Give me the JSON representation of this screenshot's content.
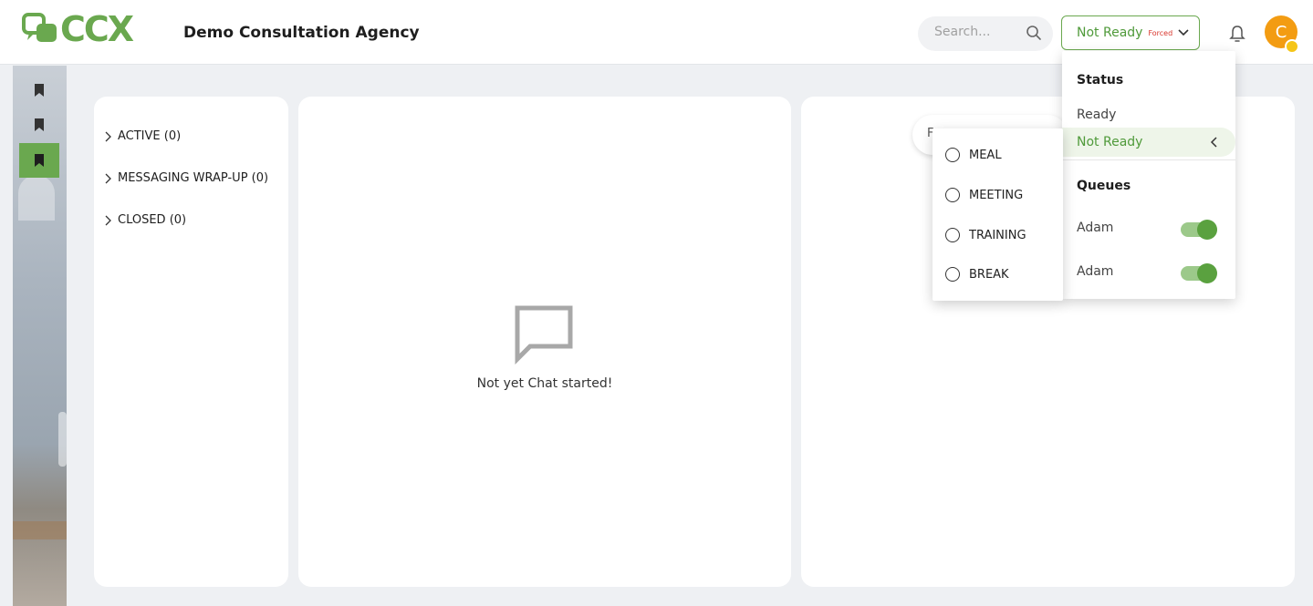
{
  "header": {
    "logo_text": "CCX",
    "org_name": "Demo Consultation Agency",
    "search_placeholder": "Search...",
    "status_label": "Not Ready",
    "status_forced": "Forced",
    "avatar_initial": "C"
  },
  "conversations": {
    "sections": [
      {
        "label": "ACTIVE (0)"
      },
      {
        "label": "MESSAGING WRAP-UP (0)"
      },
      {
        "label": "CLOSED (0)"
      }
    ]
  },
  "chat": {
    "empty_text": "Not yet Chat started!"
  },
  "right_panel": {
    "pill_text": "F"
  },
  "status_menu": {
    "status_heading": "Status",
    "ready_label": "Ready",
    "not_ready_label": "Not Ready",
    "queues_heading": "Queues",
    "queues": [
      {
        "name": "Adam",
        "enabled": true
      },
      {
        "name": "Adam",
        "enabled": true
      }
    ]
  },
  "reasons_menu": {
    "reasons": [
      "MEAL",
      "MEETING",
      "TRAINING",
      "BREAK"
    ]
  },
  "colors": {
    "brand": "#6aa84f",
    "forced": "#d9342b",
    "avatar": "#f39c12"
  }
}
